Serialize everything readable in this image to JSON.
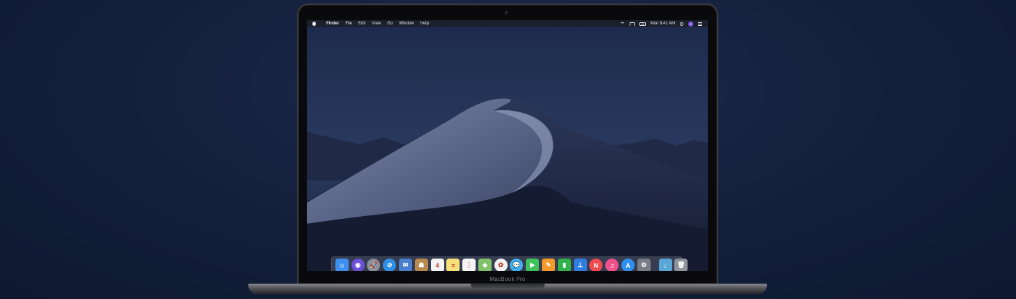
{
  "device": {
    "brand_label": "MacBook Pro"
  },
  "menubar": {
    "app_name": "Finder",
    "menus": [
      "File",
      "Edit",
      "View",
      "Go",
      "Window",
      "Help"
    ],
    "clock": "Mon 9:41 AM",
    "status_icons": [
      "wifi-icon",
      "airplay-icon",
      "battery-icon",
      "search-icon",
      "siri-icon",
      "notification-center-icon"
    ]
  },
  "dock": {
    "apps": [
      {
        "name": "finder",
        "color": "#3e8ff0",
        "glyph": "☺"
      },
      {
        "name": "siri",
        "color": "#6a4fd8",
        "glyph": "◉"
      },
      {
        "name": "launchpad",
        "color": "#8c8f99",
        "glyph": "🚀"
      },
      {
        "name": "safari",
        "color": "#2d8fe6",
        "glyph": "⊘"
      },
      {
        "name": "mail",
        "color": "#4a7fd0",
        "glyph": "✉"
      },
      {
        "name": "contacts",
        "color": "#b7894d",
        "glyph": "☗"
      },
      {
        "name": "calendar",
        "color": "#f4f4f4",
        "glyph": "4"
      },
      {
        "name": "notes",
        "color": "#f7e07a",
        "glyph": "≡"
      },
      {
        "name": "reminders",
        "color": "#f4f4f4",
        "glyph": "⋮"
      },
      {
        "name": "maps",
        "color": "#7fc26a",
        "glyph": "◈"
      },
      {
        "name": "photos",
        "color": "#f2f2f2",
        "glyph": "✿"
      },
      {
        "name": "messages",
        "color": "#3fb0f2",
        "glyph": "💬"
      },
      {
        "name": "facetime",
        "color": "#3fc25a",
        "glyph": "▶"
      },
      {
        "name": "pages",
        "color": "#f39a2a",
        "glyph": "✎"
      },
      {
        "name": "numbers",
        "color": "#2fb24a",
        "glyph": "▮"
      },
      {
        "name": "keynote",
        "color": "#2f7fe2",
        "glyph": "⊥"
      },
      {
        "name": "news",
        "color": "#f24a4f",
        "glyph": "N"
      },
      {
        "name": "itunes",
        "color": "#f0508c",
        "glyph": "♫"
      },
      {
        "name": "app-store",
        "color": "#2f8ff0",
        "glyph": "A"
      },
      {
        "name": "system-preferences",
        "color": "#7a7d85",
        "glyph": "⚙"
      }
    ],
    "trailing": [
      {
        "name": "downloads-folder",
        "color": "#5aa6d6",
        "glyph": "↓"
      },
      {
        "name": "trash",
        "color": "#8f939a",
        "glyph": "🗑"
      }
    ],
    "running": [
      "finder"
    ]
  }
}
